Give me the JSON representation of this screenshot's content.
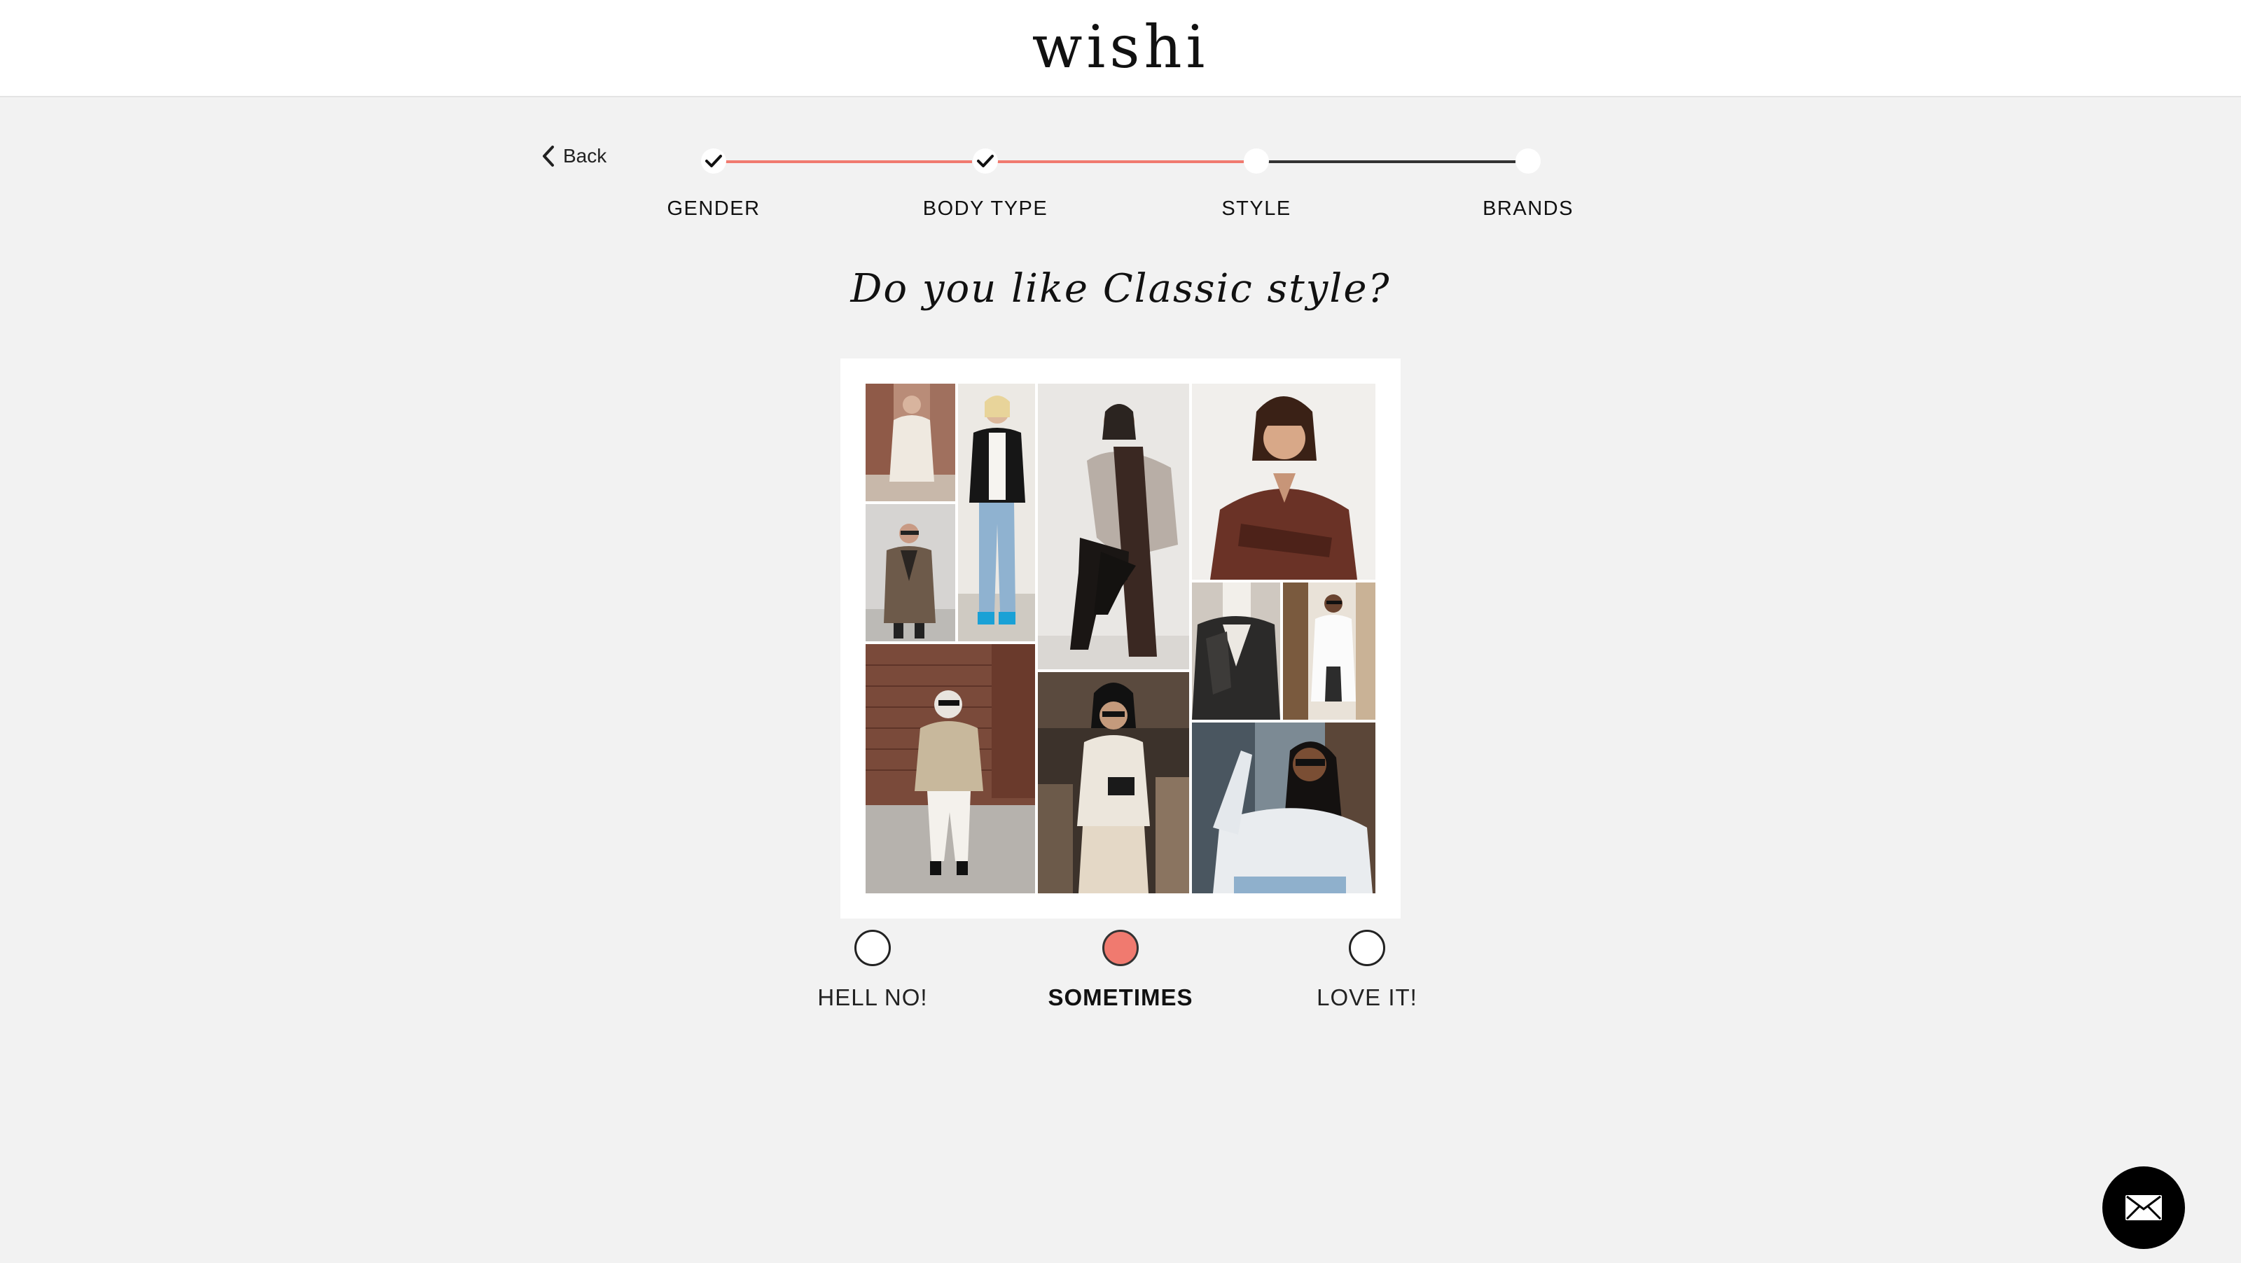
{
  "header": {
    "logo": "wishi"
  },
  "nav": {
    "back_label": "Back",
    "back_icon": "chevron-left-icon"
  },
  "stepper": {
    "steps": [
      {
        "label": "GENDER",
        "status": "completed"
      },
      {
        "label": "BODY TYPE",
        "status": "completed"
      },
      {
        "label": "STYLE",
        "status": "current"
      },
      {
        "label": "BRANDS",
        "status": "upcoming"
      }
    ],
    "accent_color": "#f07a6f",
    "pending_color": "#333333"
  },
  "question": "Do you like Classic style?",
  "collage": {
    "photos": [
      "woman in cream turtleneck sweater dress",
      "woman in tweed blazer and sunglasses",
      "woman in black blazer and light jeans",
      "seated woman in grey sweater and tall black boots",
      "woman in sheer brown blouse",
      "black leather jacket over white turtleneck",
      "woman in long white coat",
      "woman in beige cable knit sweater and white jeans",
      "woman in white turtleneck and cream trousers",
      "woman in light grey shirt and sunglasses"
    ]
  },
  "options": [
    {
      "label": "HELL NO!",
      "selected": false
    },
    {
      "label": "SOMETIMES",
      "selected": true
    },
    {
      "label": "LOVE IT!",
      "selected": false
    }
  ],
  "chat": {
    "icon": "envelope-icon"
  }
}
